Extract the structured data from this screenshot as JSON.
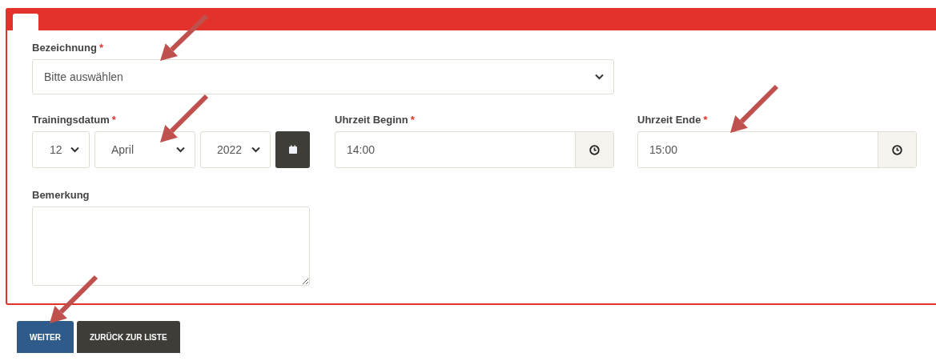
{
  "form": {
    "designation": {
      "label": "Bezeichnung",
      "required_mark": "*",
      "value": "Bitte auswählen"
    },
    "training_date": {
      "label": "Trainingsdatum",
      "required_mark": "*",
      "day": "12",
      "month": "April",
      "year": "2022"
    },
    "time_start": {
      "label": "Uhrzeit Beginn",
      "required_mark": "*",
      "value": "14:00"
    },
    "time_end": {
      "label": "Uhrzeit Ende",
      "required_mark": "*",
      "value": "15:00"
    },
    "remark": {
      "label": "Bemerkung"
    }
  },
  "buttons": [
    {
      "label": "WEITER",
      "kind": "primary"
    },
    {
      "label": "ZURÜCK ZUR LISTE",
      "kind": "secondary"
    }
  ]
}
